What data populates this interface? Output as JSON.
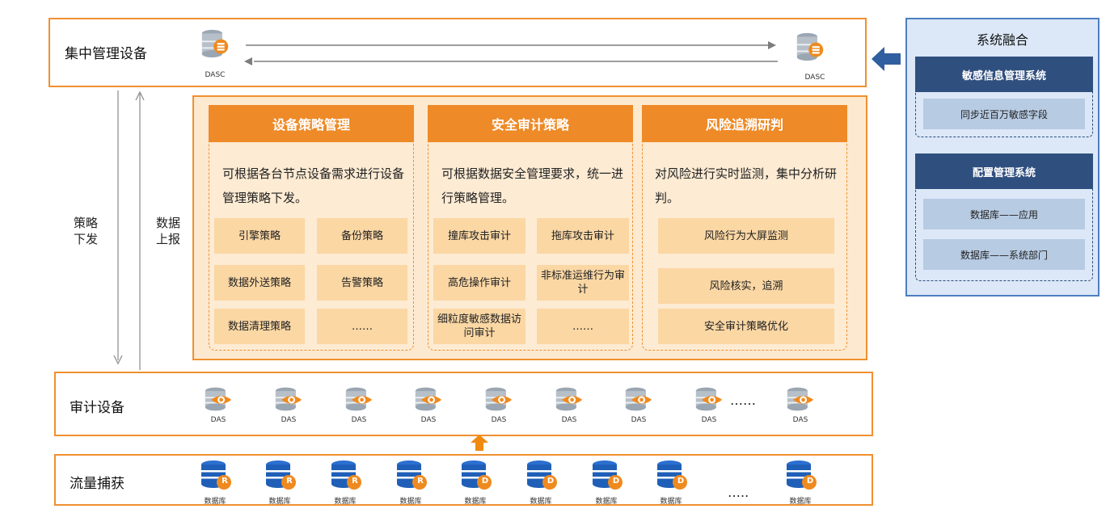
{
  "top": {
    "label": "集中管理设备",
    "left_icon_label": "DASC",
    "right_icon_label": "DASC"
  },
  "side_labels": {
    "down": "策略\n下发",
    "up": "数据\n上报"
  },
  "columns": [
    {
      "title": "设备策略管理",
      "desc": "可根据各台节点设备需求进行设备管理策略下发。",
      "cells": [
        "引擎策略",
        "备份策略",
        "数据外送策略",
        "告警策略",
        "数据清理策略",
        "……"
      ]
    },
    {
      "title": "安全审计策略",
      "desc": "可根据数据安全管理要求，统一进行策略管理。",
      "cells": [
        "撞库攻击审计",
        "拖库攻击审计",
        "高危操作审计",
        "非标准运维行为审计",
        "细粒度敏感数据访问审计",
        "……"
      ]
    },
    {
      "title": "风险追溯研判",
      "desc": "对风险进行实时监测，集中分析研判。",
      "cells": [
        "风险行为大屏监测",
        "风险核实，追溯",
        "安全审计策略优化"
      ]
    }
  ],
  "audit": {
    "label": "审计设备",
    "icon_label": "DAS",
    "ellipsis": "……"
  },
  "capture": {
    "label": "流量捕获",
    "icon_label": "数据库",
    "badges": [
      "R",
      "R",
      "R",
      "R",
      "D",
      "D",
      "D",
      "D",
      "D"
    ],
    "ellipsis": "….."
  },
  "system": {
    "title": "系统融合",
    "groups": [
      {
        "header": "敏感信息管理系统",
        "items": [
          "同步近百万敏感字段"
        ]
      },
      {
        "header": "配置管理系统",
        "items": [
          "数据库——应用",
          "数据库——系统部门"
        ]
      }
    ]
  },
  "colors": {
    "orange": "#ee8a27",
    "orange_light": "#fbd7a4",
    "navy": "#2f4f7f",
    "blue_db": "#1f5fb8"
  }
}
